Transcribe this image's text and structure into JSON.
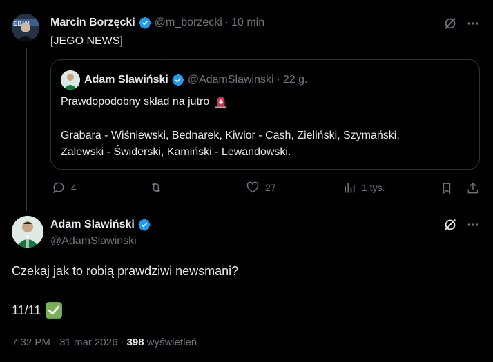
{
  "parent_tweet": {
    "author_name": "Marcin Borzęcki",
    "handle": "@m_borzecki",
    "time": "10 min",
    "text": "[JEGO NEWS]",
    "quoted": {
      "author_name": "Adam Slawiński",
      "handle": "@AdamSlawinski",
      "time": "22 g.",
      "line1": "Prawdopodobny skład na jutro",
      "line2": "Grabara - Wiśniewski, Bednarek, Kiwior - Cash, Zieliński, Szymański,",
      "line3": "Zalewski - Świderski, Kamiński - Lewandowski."
    },
    "actions": {
      "replies": "4",
      "retweets": "",
      "likes": "27",
      "views": "1 tys."
    }
  },
  "main_tweet": {
    "author_name": "Adam Slawiński",
    "handle": "@AdamSlawinski",
    "text_line1": "Czekaj jak to robią prawdziwi newsmani?",
    "text_line2": "11/11",
    "meta_time": "7:32 PM · 31 mar 2026 ·",
    "views_count": "398",
    "views_label": "wyświetleń"
  },
  "colors": {
    "background": "#000000",
    "text": "#e7e9ea",
    "muted": "#71767b",
    "verified": "#1d9bf0",
    "border": "#2f3336",
    "thread_line": "#333639",
    "checkmark_green": "#77b255",
    "siren_red": "#dd2e44"
  }
}
